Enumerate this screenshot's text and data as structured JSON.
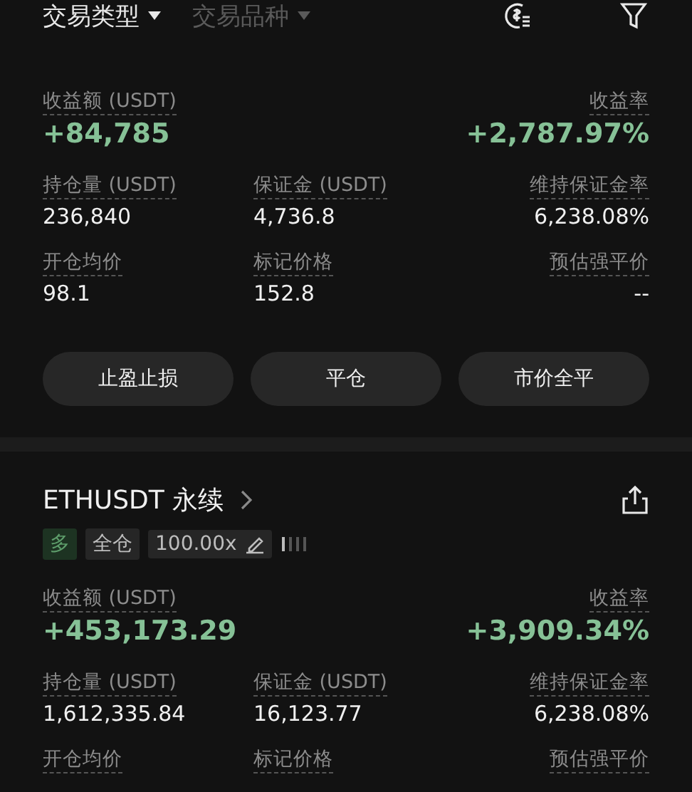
{
  "filters": [
    {
      "label": "交易类型",
      "selected": true
    },
    {
      "label": "交易品种",
      "selected": false
    }
  ],
  "positions": [
    {
      "pnl": {
        "label": "收益额 (USDT)",
        "value": "+84,785"
      },
      "rate": {
        "label": "收益率",
        "value": "+2,787.97%"
      },
      "fields": [
        {
          "label": "持仓量 (USDT)",
          "value": "236,840"
        },
        {
          "label": "保证金 (USDT)",
          "value": "4,736.8"
        },
        {
          "label": "维持保证金率",
          "value": "6,238.08%"
        },
        {
          "label": "开仓均价",
          "value": "98.1"
        },
        {
          "label": "标记价格",
          "value": "152.8"
        },
        {
          "label": "预估强平价",
          "value": "--"
        }
      ],
      "buttons": [
        "止盈止损",
        "平仓",
        "市价全平"
      ]
    },
    {
      "title": "ETHUSDT 永续",
      "tags": [
        {
          "kind": "side",
          "text": "多"
        },
        {
          "kind": "mode",
          "text": "全仓"
        },
        {
          "kind": "leverage",
          "text": "100.00x"
        }
      ],
      "pnl": {
        "label": "收益额 (USDT)",
        "value": "+453,173.29"
      },
      "rate": {
        "label": "收益率",
        "value": "+3,909.34%"
      },
      "fields": [
        {
          "label": "持仓量 (USDT)",
          "value": "1,612,335.84"
        },
        {
          "label": "保证金 (USDT)",
          "value": "16,123.77"
        },
        {
          "label": "维持保证金率",
          "value": "6,238.08%"
        },
        {
          "label": "开仓均价"
        },
        {
          "label": "标记价格"
        },
        {
          "label": "预估强平价"
        }
      ]
    }
  ]
}
